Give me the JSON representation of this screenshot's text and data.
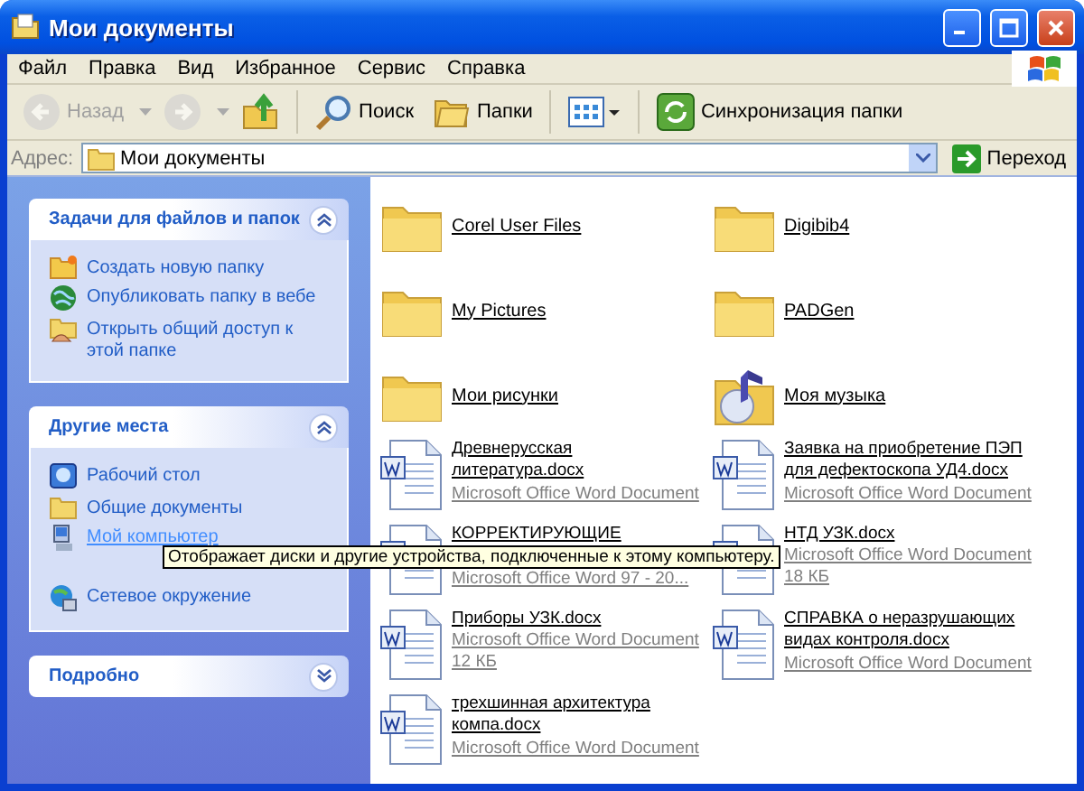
{
  "window": {
    "title": "Мои документы"
  },
  "menu": [
    "Файл",
    "Правка",
    "Вид",
    "Избранное",
    "Сервис",
    "Справка"
  ],
  "toolbar": [
    {
      "kind": "back",
      "label": "Назад",
      "disabled": true
    },
    {
      "kind": "forward",
      "disabled": true
    },
    {
      "kind": "up",
      "disabled": false
    },
    {
      "kind": "search",
      "label": "Поиск",
      "disabled": false
    },
    {
      "kind": "folders",
      "label": "Папки",
      "disabled": false
    },
    {
      "kind": "views",
      "disabled": false
    },
    {
      "kind": "sync",
      "label": "Синхронизация папки",
      "disabled": false
    }
  ],
  "address": {
    "label": "Адрес:",
    "value": "Мои документы",
    "go": "Переход"
  },
  "panels": [
    {
      "title": "Задачи для файлов и папок",
      "expanded": true,
      "items": [
        {
          "kind": "new-folder",
          "label": "Создать новую папку",
          "hovered": false
        },
        {
          "kind": "globe",
          "label": "Опубликовать папку в вебе",
          "hovered": false
        },
        {
          "kind": "share",
          "label": "Открыть общий доступ к этой папке",
          "hovered": false
        }
      ]
    },
    {
      "title": "Другие места",
      "expanded": true,
      "items": [
        {
          "kind": "desktop",
          "label": "Рабочий стол",
          "hovered": false
        },
        {
          "kind": "folder",
          "label": "Общие документы",
          "hovered": false
        },
        {
          "kind": "computer",
          "label": "Мой компьютер",
          "hovered": true
        },
        {
          "kind": "network",
          "label": "Сетевое окружение",
          "hovered": false
        }
      ]
    },
    {
      "title": "Подробно",
      "expanded": false
    }
  ],
  "files": [
    {
      "kind": "folder",
      "name": "Corel User Files"
    },
    {
      "kind": "folder",
      "name": "Digibib4"
    },
    {
      "kind": "folder",
      "name": "My Pictures"
    },
    {
      "kind": "folder",
      "name": "PADGen"
    },
    {
      "kind": "folder",
      "name": "Мои рисунки"
    },
    {
      "kind": "music",
      "name": "Моя музыка"
    },
    {
      "kind": "doc",
      "name": "Древнерусская литература.docx",
      "type": "Microsoft Office Word Document"
    },
    {
      "kind": "doc",
      "name": "Заявка на приобретение ПЭП для дефектоскопа УД4.docx",
      "type": "Microsoft Office Word Document"
    },
    {
      "kind": "doc",
      "name": "КОРРЕКТИРУЮЩИЕ",
      "type": "Microsoft Office Word 97 - 20..."
    },
    {
      "kind": "doc",
      "name": "НТД УЗК.docx",
      "type": "Microsoft Office Word Document",
      "size": "18 КБ"
    },
    {
      "kind": "doc",
      "name": "Приборы УЗК.docx",
      "type": "Microsoft Office Word Document",
      "size": "12 КБ"
    },
    {
      "kind": "doc",
      "name": "СПРАВКА о неразрушающих видах контроля.docx",
      "type": "Microsoft Office Word Document"
    },
    {
      "kind": "doc",
      "name": "трехшинная архитектура компа.docx",
      "type": "Microsoft Office Word Document"
    }
  ],
  "tooltip": "Отображает диски и другие устройства, подключенные к этому компьютеру."
}
